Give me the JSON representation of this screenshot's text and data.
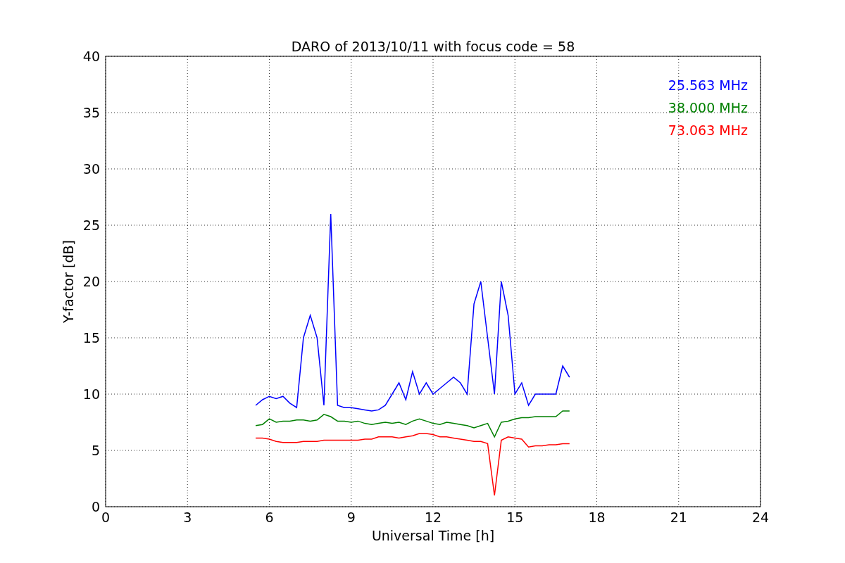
{
  "chart_data": {
    "type": "line",
    "title": "DARO of 2013/10/11 with focus code = 58",
    "xlabel": "Universal Time [h]",
    "ylabel": "Y-factor [dB]",
    "x": [
      5.5,
      5.75,
      6,
      6.25,
      6.5,
      6.75,
      7,
      7.25,
      7.5,
      7.75,
      8,
      8.25,
      8.5,
      8.75,
      9,
      9.25,
      9.5,
      9.75,
      10,
      10.25,
      10.5,
      10.75,
      11,
      11.25,
      11.5,
      11.75,
      12,
      12.25,
      12.5,
      12.75,
      13,
      13.25,
      13.5,
      13.75,
      14,
      14.25,
      14.5,
      14.75,
      15,
      15.25,
      15.5,
      15.75,
      16,
      16.25,
      16.5,
      16.75,
      17
    ],
    "series": [
      {
        "name": "25.563 MHz",
        "color": "#0000ff",
        "values": [
          9,
          9.5,
          9.8,
          9.6,
          9.8,
          9.2,
          8.8,
          15,
          17,
          15,
          9,
          26,
          9,
          8.8,
          8.8,
          8.7,
          8.6,
          8.5,
          8.6,
          9,
          10,
          11,
          9.5,
          12,
          10,
          11,
          10,
          10.5,
          11,
          11.5,
          11,
          10,
          18,
          20,
          15,
          10,
          20,
          17,
          10,
          11,
          9,
          10,
          10,
          10,
          10,
          12.5,
          11.5
        ]
      },
      {
        "name": "38.000 MHz",
        "color": "#008000",
        "values": [
          7.2,
          7.3,
          7.8,
          7.5,
          7.6,
          7.6,
          7.7,
          7.7,
          7.6,
          7.7,
          8.2,
          8,
          7.6,
          7.6,
          7.5,
          7.6,
          7.4,
          7.3,
          7.4,
          7.5,
          7.4,
          7.5,
          7.3,
          7.6,
          7.8,
          7.6,
          7.4,
          7.3,
          7.5,
          7.4,
          7.3,
          7.2,
          7,
          7.2,
          7.4,
          6.2,
          7.5,
          7.6,
          7.8,
          7.9,
          7.9,
          8,
          8,
          8,
          8,
          8.5,
          8.5
        ]
      },
      {
        "name": "73.063 MHz",
        "color": "#ff0000",
        "values": [
          6.1,
          6.1,
          6,
          5.8,
          5.7,
          5.7,
          5.7,
          5.8,
          5.8,
          5.8,
          5.9,
          5.9,
          5.9,
          5.9,
          5.9,
          5.9,
          6,
          6,
          6.2,
          6.2,
          6.2,
          6.1,
          6.2,
          6.3,
          6.5,
          6.5,
          6.4,
          6.2,
          6.2,
          6.1,
          6,
          5.9,
          5.8,
          5.8,
          5.6,
          1,
          5.9,
          6.2,
          6.1,
          6,
          5.3,
          5.4,
          5.4,
          5.5,
          5.5,
          5.6,
          5.6
        ]
      }
    ],
    "grid": true,
    "xlim": [
      0,
      24
    ],
    "ylim": [
      0,
      40
    ],
    "xticks": [
      0,
      3,
      6,
      9,
      12,
      15,
      18,
      21,
      24
    ],
    "yticks": [
      0,
      5,
      10,
      15,
      20,
      25,
      30,
      35,
      40
    ]
  }
}
